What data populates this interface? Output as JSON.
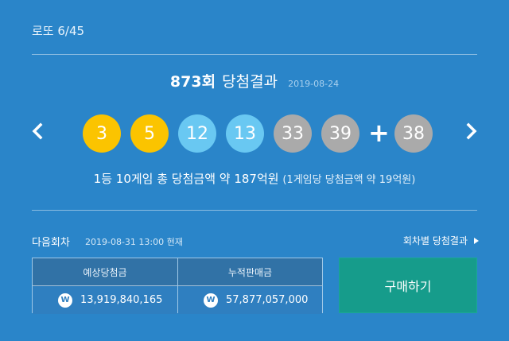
{
  "app": {
    "title": "로또 6/45"
  },
  "draw": {
    "round": "873",
    "round_suffix": "회",
    "heading": "당첨결과",
    "date": "2019-08-24"
  },
  "balls": [
    {
      "number": "3",
      "color": "#fbc400"
    },
    {
      "number": "5",
      "color": "#fbc400"
    },
    {
      "number": "12",
      "color": "#69c8f2"
    },
    {
      "number": "13",
      "color": "#69c8f2"
    },
    {
      "number": "33",
      "color": "#aaaaaa"
    },
    {
      "number": "39",
      "color": "#aaaaaa"
    }
  ],
  "plus_sign": "+",
  "bonus": {
    "number": "38",
    "color": "#aaaaaa"
  },
  "prize": {
    "main": "1등 10게임 총 당첨금액 약 187억원",
    "sub": "(1게임당 당첨금액 약 19억원)"
  },
  "next": {
    "label": "다음회차",
    "time": "2019-08-31 13:00 현재",
    "history_link": "회차별 당첨결과"
  },
  "stats": {
    "expected_label": "예상당첨금",
    "expected_value": "13,919,840,165",
    "cumulative_label": "누적판매금",
    "cumulative_value": "57,877,057,000",
    "won_symbol": "W"
  },
  "buy_button": "구매하기",
  "icons": {
    "prev": "chevron-left-icon",
    "next": "chevron-right-icon",
    "won": "won-icon",
    "link": "triangle-right-icon"
  }
}
